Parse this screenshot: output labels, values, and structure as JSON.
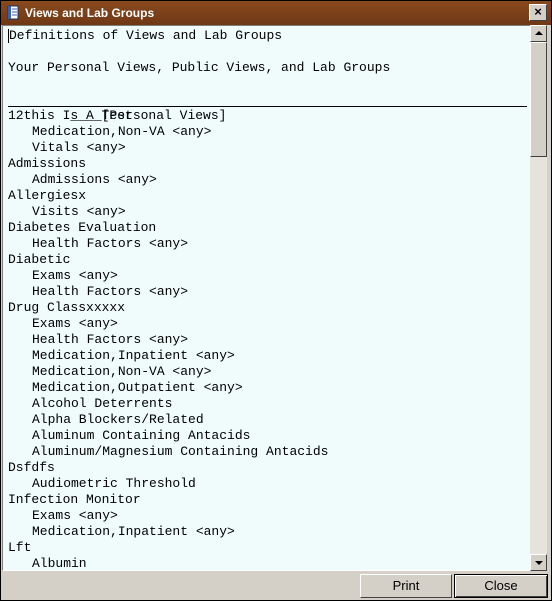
{
  "window": {
    "title": "Views and Lab Groups"
  },
  "content": {
    "heading": "Definitions of Views and Lab Groups",
    "subheading": "Your Personal Views, Public Views, and Lab Groups",
    "section_title": "____[Personal Views]",
    "lines": [
      {
        "text": "12this Is A Test",
        "indent": false
      },
      {
        "text": "Medication,Non-VA <any>",
        "indent": true
      },
      {
        "text": "Vitals <any>",
        "indent": true
      },
      {
        "text": "Admissions",
        "indent": false
      },
      {
        "text": "Admissions <any>",
        "indent": true
      },
      {
        "text": "Allergiesx",
        "indent": false
      },
      {
        "text": "Visits <any>",
        "indent": true
      },
      {
        "text": "Diabetes Evaluation",
        "indent": false
      },
      {
        "text": "Health Factors <any>",
        "indent": true
      },
      {
        "text": "Diabetic",
        "indent": false
      },
      {
        "text": "Exams <any>",
        "indent": true
      },
      {
        "text": "Health Factors <any>",
        "indent": true
      },
      {
        "text": "Drug Classxxxxx",
        "indent": false
      },
      {
        "text": "Exams <any>",
        "indent": true
      },
      {
        "text": "Health Factors <any>",
        "indent": true
      },
      {
        "text": "Medication,Inpatient <any>",
        "indent": true
      },
      {
        "text": "Medication,Non-VA <any>",
        "indent": true
      },
      {
        "text": "Medication,Outpatient <any>",
        "indent": true
      },
      {
        "text": "Alcohol Deterrents",
        "indent": true
      },
      {
        "text": "Alpha Blockers/Related",
        "indent": true
      },
      {
        "text": "Aluminum Containing Antacids",
        "indent": true
      },
      {
        "text": "Aluminum/Magnesium Containing Antacids",
        "indent": true
      },
      {
        "text": "Dsfdfs",
        "indent": false
      },
      {
        "text": "Audiometric Threshold",
        "indent": true
      },
      {
        "text": "Infection Monitor",
        "indent": false
      },
      {
        "text": "Exams <any>",
        "indent": true
      },
      {
        "text": "Medication,Inpatient <any>",
        "indent": true
      },
      {
        "text": "Lft",
        "indent": false
      },
      {
        "text": "Albumin",
        "indent": true
      }
    ]
  },
  "footer": {
    "print_label": "Print",
    "close_label": "Close"
  },
  "icons": {
    "window_icon": "notebook-icon",
    "close_icon": "close-icon"
  }
}
